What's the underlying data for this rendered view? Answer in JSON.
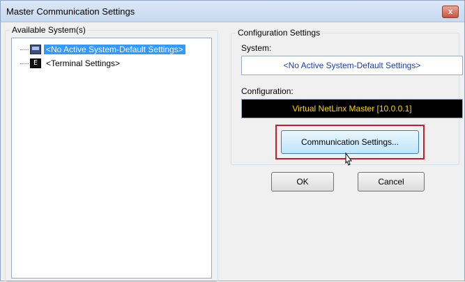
{
  "window": {
    "title": "Master Communication Settings",
    "close_glyph": "x"
  },
  "available_systems": {
    "label": "Available System(s)",
    "items": [
      {
        "label": "<No Active System-Default Settings>",
        "icon": "system-icon",
        "selected": true
      },
      {
        "label": "<Terminal Settings>",
        "icon": "terminal-icon",
        "selected": false
      }
    ]
  },
  "configuration_settings": {
    "label": "Configuration Settings",
    "system_label": "System:",
    "system_value": "<No Active System-Default Settings>",
    "configuration_label": "Configuration:",
    "configuration_value": "Virtual NetLinx Master [10.0.0.1]",
    "communication_button": "Communication Settings..."
  },
  "buttons": {
    "ok": "OK",
    "cancel": "Cancel"
  },
  "colors": {
    "selection": "#3399ff",
    "highlight_border": "#b8232f",
    "config_text": "#ffd400"
  }
}
